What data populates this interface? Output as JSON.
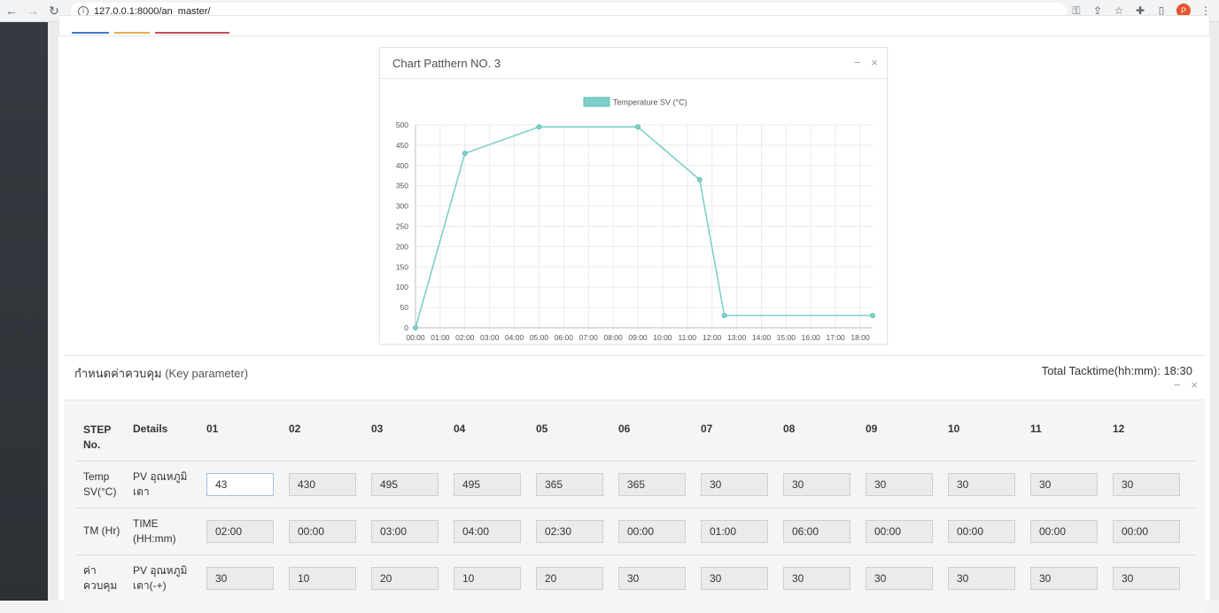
{
  "browser": {
    "url": "127.0.0.1:8000/an_master/",
    "avatar_letter": "P"
  },
  "chart_card": {
    "title": "Chart Patthern NO. 3",
    "minimize": "−",
    "close": "×"
  },
  "chart_data": {
    "type": "line",
    "x": [
      "00:00",
      "02:00",
      "05:00",
      "09:00",
      "11:30",
      "12:30",
      "18:30"
    ],
    "x_ticks": [
      "00:00",
      "01:00",
      "02:00",
      "03:00",
      "04:00",
      "05:00",
      "06:00",
      "07:00",
      "08:00",
      "09:00",
      "10:00",
      "11:00",
      "12:00",
      "13:00",
      "14:00",
      "15:00",
      "16:00",
      "17:00",
      "18:00"
    ],
    "series": [
      {
        "name": "Temperature SV (°C)",
        "color": "#7ed0c9",
        "x_hours": [
          0,
          2,
          5,
          9,
          11.5,
          12.5,
          18.5
        ],
        "values": [
          0,
          430,
          495,
          495,
          365,
          30,
          30
        ]
      }
    ],
    "y_ticks": [
      0,
      50,
      100,
      150,
      200,
      250,
      300,
      350,
      400,
      450,
      500
    ],
    "ylim": [
      0,
      500
    ],
    "xlim_hours": [
      0,
      18.5
    ],
    "grid": true,
    "legend": "top"
  },
  "param": {
    "title_th": "กำหนดค่าควบคุม",
    "title_en": "(Key parameter)",
    "total_label": "Total Tacktime(hh:mm):",
    "total_value": "18:30",
    "minimize": "−",
    "close": "×",
    "header": {
      "step": "STEP No.",
      "details": "Details",
      "steps": [
        "01",
        "02",
        "03",
        "04",
        "05",
        "06",
        "07",
        "08",
        "09",
        "10",
        "11",
        "12"
      ]
    },
    "rows": [
      {
        "step": "Temp SV(°C)",
        "details": "PV อุณหภูมิเตา",
        "values": [
          "43",
          "430",
          "495",
          "495",
          "365",
          "365",
          "30",
          "30",
          "30",
          "30",
          "30",
          "30"
        ]
      },
      {
        "step": "TM (Hr)",
        "details": "TIME (HH:mm)",
        "values": [
          "02:00",
          "00:00",
          "03:00",
          "04:00",
          "02:30",
          "00:00",
          "01:00",
          "06:00",
          "00:00",
          "00:00",
          "00:00",
          "00:00"
        ]
      },
      {
        "step": "ค่าควบคุม",
        "details": "PV อุณหภูมิเตา(-+)",
        "values": [
          "30",
          "10",
          "20",
          "10",
          "20",
          "30",
          "30",
          "30",
          "30",
          "30",
          "30",
          "30"
        ]
      }
    ]
  }
}
